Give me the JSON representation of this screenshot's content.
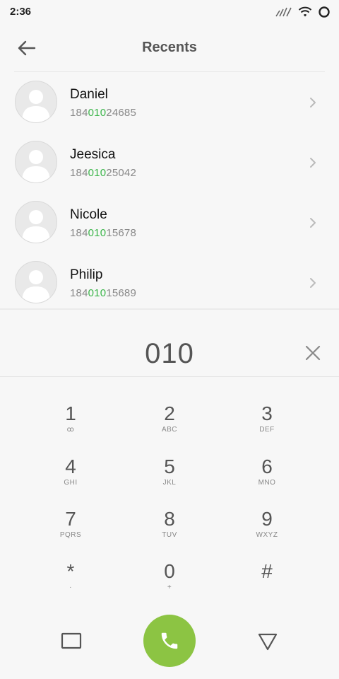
{
  "status_bar": {
    "time": "2:36",
    "icons": [
      "signal-icon",
      "wifi-icon",
      "battery-ring-icon"
    ]
  },
  "header": {
    "title": "Recents",
    "back_icon": "arrow-left-icon"
  },
  "contacts": [
    {
      "name": "Daniel",
      "number_prefix": "184",
      "number_match": "010",
      "number_suffix": "24685"
    },
    {
      "name": "Jeesica",
      "number_prefix": "184",
      "number_match": "010",
      "number_suffix": "25042"
    },
    {
      "name": "Nicole",
      "number_prefix": "184",
      "number_match": "010",
      "number_suffix": "15678"
    },
    {
      "name": "Philip",
      "number_prefix": "184",
      "number_match": "010",
      "number_suffix": "15689"
    }
  ],
  "dial": {
    "number": "010",
    "clear_icon": "close-icon"
  },
  "keypad": [
    {
      "digit": "1",
      "letters": "ꝏ"
    },
    {
      "digit": "2",
      "letters": "ABC"
    },
    {
      "digit": "3",
      "letters": "DEF"
    },
    {
      "digit": "4",
      "letters": "GHI"
    },
    {
      "digit": "5",
      "letters": "JKL"
    },
    {
      "digit": "6",
      "letters": "MNO"
    },
    {
      "digit": "7",
      "letters": "PQRS"
    },
    {
      "digit": "8",
      "letters": "TUV"
    },
    {
      "digit": "9",
      "letters": "WXYZ"
    },
    {
      "digit": "*",
      "letters": "·"
    },
    {
      "digit": "0",
      "letters": "+"
    },
    {
      "digit": "#",
      "letters": ""
    }
  ],
  "bottom_bar": {
    "left_icon": "square-icon",
    "call_icon": "phone-icon",
    "right_icon": "triangle-down-icon"
  },
  "colors": {
    "accent_green": "#8cc443",
    "match_highlight": "#3bb54a",
    "background": "#f7f7f7"
  }
}
